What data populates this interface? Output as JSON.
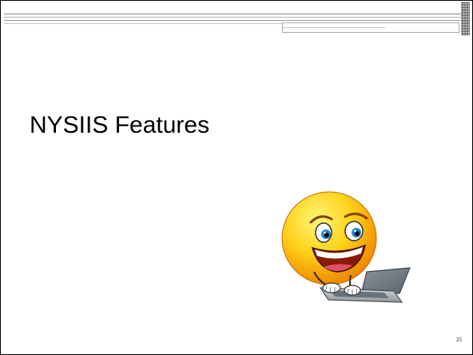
{
  "slide": {
    "title": "NYSIIS Features",
    "page_number": "25"
  },
  "clipart": {
    "icon": "smiley-laptop-icon"
  },
  "colors": {
    "background": "#ffffff",
    "text": "#000000",
    "face": "#f7b500",
    "eye_iris": "#1e88d6",
    "laptop": "#9aa3ad"
  }
}
